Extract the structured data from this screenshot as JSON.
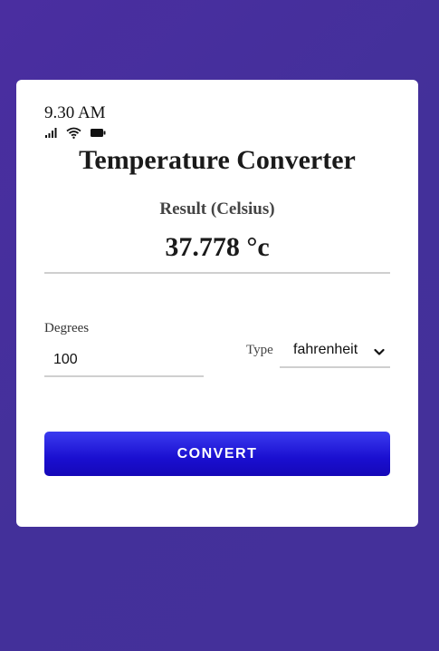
{
  "status_bar": {
    "time": "9.30 AM",
    "icons": [
      "signal-icon",
      "wifi-icon",
      "battery-icon"
    ]
  },
  "app": {
    "title": "Temperature Converter"
  },
  "result": {
    "label": "Result (Celsius)",
    "value": "37.778 °c"
  },
  "form": {
    "degrees_label": "Degrees",
    "degrees_value": "100",
    "type_label": "Type",
    "type_selected": "fahrenheit"
  },
  "actions": {
    "convert_label": "CONVERT"
  },
  "colors": {
    "background": "#4a2ea0",
    "card": "#ffffff",
    "button": "#1a0fd0",
    "button_text": "#ffffff",
    "divider": "#cfcfcf"
  }
}
